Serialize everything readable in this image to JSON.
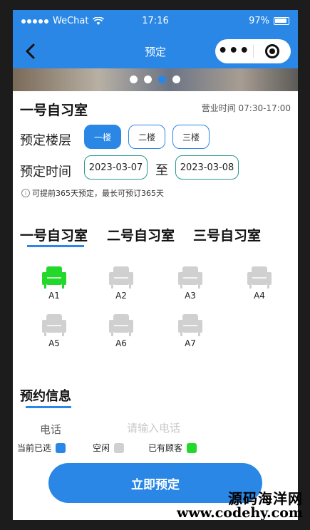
{
  "status_bar": {
    "carrier": "WeChat",
    "time": "17:16",
    "battery": "97%"
  },
  "nav": {
    "title": "预定",
    "more_label": "•••"
  },
  "banner": {
    "slides": 4,
    "active_slide": 3
  },
  "room": {
    "name": "一号自习室",
    "hours": "营业时间 07:30-17:00"
  },
  "floor": {
    "label": "预定楼层",
    "options": [
      "一楼",
      "二楼",
      "三楼"
    ],
    "selected": "一楼"
  },
  "time": {
    "label": "预定时间",
    "start": "2023-03-07",
    "separator": "至",
    "end": "2023-03-08"
  },
  "note": "可提前365天预定，最长可预订365天",
  "tabs": [
    {
      "label": "一号自习室",
      "active": true
    },
    {
      "label": "二号自习室",
      "active": false
    },
    {
      "label": "三号自习室",
      "active": false
    }
  ],
  "seats": [
    {
      "label": "A1",
      "status": "occupied"
    },
    {
      "label": "A2",
      "status": "free"
    },
    {
      "label": "A3",
      "status": "free"
    },
    {
      "label": "A4",
      "status": "free"
    },
    {
      "label": "A5",
      "status": "free"
    },
    {
      "label": "A6",
      "status": "free"
    },
    {
      "label": "A7",
      "status": "free"
    }
  ],
  "booking_info": {
    "title": "预约信息",
    "phone_label": "电话",
    "phone_placeholder": "请输入电话"
  },
  "legend": [
    {
      "label": "当前已选",
      "color": "#2a87e6"
    },
    {
      "label": "空闲",
      "color": "#d0d0d0"
    },
    {
      "label": "已有顾客",
      "color": "#22d82a"
    }
  ],
  "submit_label": "立即预定",
  "watermark": {
    "name": "源码海洋网",
    "url": "www.codehy.com"
  },
  "colors": {
    "primary": "#2a87e6",
    "free": "#d0d0d0",
    "occupied": "#22d82a"
  }
}
